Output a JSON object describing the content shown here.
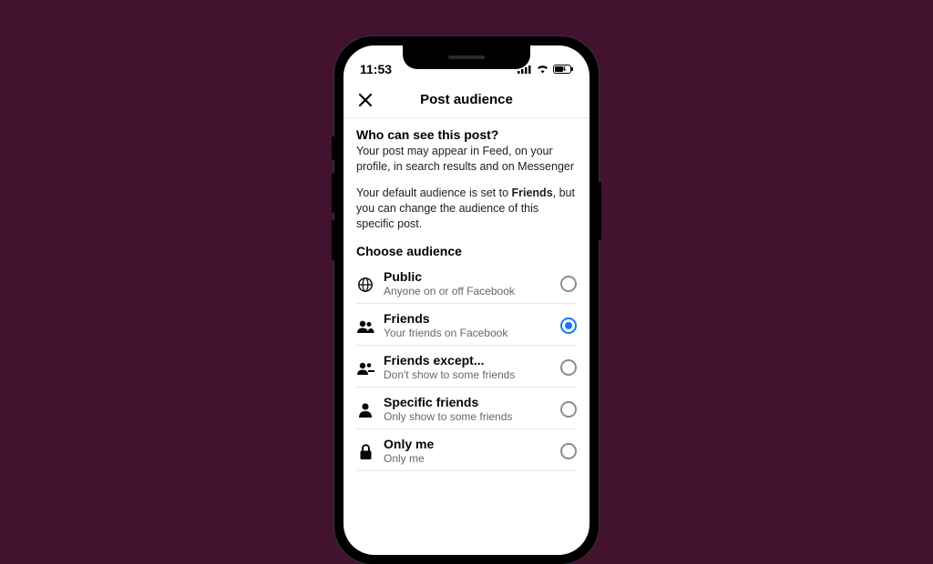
{
  "status": {
    "time": "11:53",
    "battery": "54"
  },
  "header": {
    "title": "Post audience"
  },
  "intro": {
    "question": "Who can see this post?",
    "line1": "Your post may appear in Feed, on your profile, in search results and on Messenger",
    "line2_a": "Your default audience is set to ",
    "line2_bold": "Friends",
    "line2_b": ", but you can change the audience of this specific post."
  },
  "choose_label": "Choose audience",
  "options": [
    {
      "icon": "globe",
      "label": "Public",
      "desc": "Anyone on or off Facebook",
      "selected": false
    },
    {
      "icon": "friends",
      "label": "Friends",
      "desc": "Your friends on Facebook",
      "selected": true
    },
    {
      "icon": "friends-minus",
      "label": "Friends except...",
      "desc": "Don't show to some friends",
      "selected": false
    },
    {
      "icon": "person",
      "label": "Specific friends",
      "desc": "Only show to some friends",
      "selected": false
    },
    {
      "icon": "lock",
      "label": "Only me",
      "desc": "Only me",
      "selected": false
    }
  ]
}
